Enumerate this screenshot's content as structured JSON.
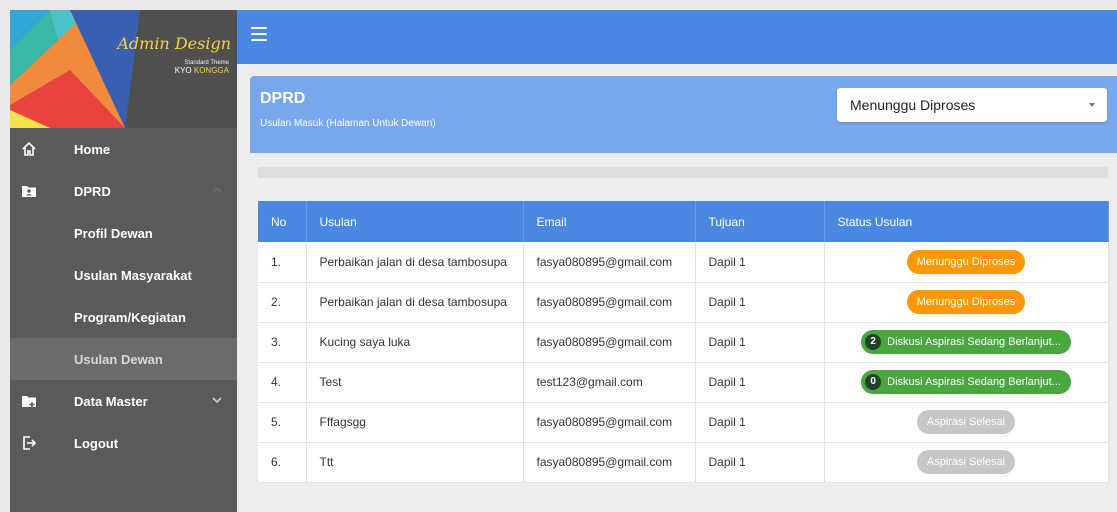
{
  "brand": {
    "title": "Admin Design",
    "subtitle": "Standard Theme",
    "credit_prefix": "KYO ",
    "credit_accent": "KONGGA"
  },
  "sidebar": {
    "items": [
      {
        "label": "Home",
        "icon": "home-icon"
      },
      {
        "label": "DPRD",
        "icon": "folder-user-icon"
      },
      {
        "label": "Profil Dewan"
      },
      {
        "label": "Usulan Masyarakat"
      },
      {
        "label": "Program/Kegiatan"
      },
      {
        "label": "Usulan Dewan"
      },
      {
        "label": "Data Master",
        "icon": "folder-plus-icon"
      },
      {
        "label": "Logout",
        "icon": "logout-icon"
      }
    ]
  },
  "header": {
    "title": "DPRD",
    "subtitle": "Usulan Masuk (Halaman Untuk Dewan)",
    "filter_value": "Menunggu Diproses"
  },
  "table": {
    "columns": [
      "No",
      "Usulan",
      "Email",
      "Tujuan",
      "Status Usulan"
    ],
    "rows": [
      {
        "no": "1.",
        "usulan": "Perbaikan jalan di desa tambosupa",
        "email": "fasya080895@gmail.com",
        "tujuan": "Dapil 1",
        "status": "Menunggu Diproses",
        "count": ""
      },
      {
        "no": "2.",
        "usulan": "Perbaikan jalan di desa tambosupa",
        "email": "fasya080895@gmail.com",
        "tujuan": "Dapil 1",
        "status": "Menunggu Diproses",
        "count": ""
      },
      {
        "no": "3.",
        "usulan": "Kucing saya luka",
        "email": "fasya080895@gmail.com",
        "tujuan": "Dapil 1",
        "status": "Diskusi Aspirasi Sedang Berlanjut...",
        "count": "2"
      },
      {
        "no": "4.",
        "usulan": "Test",
        "email": "test123@gmail.com",
        "tujuan": "Dapil 1",
        "status": "Diskusi Aspirasi Sedang Berlanjut...",
        "count": "0"
      },
      {
        "no": "5.",
        "usulan": "Fffagsgg",
        "email": "fasya080895@gmail.com",
        "tujuan": "Dapil 1",
        "status": "Aspirasi Selesai",
        "count": ""
      },
      {
        "no": "6.",
        "usulan": "Ttt",
        "email": "fasya080895@gmail.com",
        "tujuan": "Dapil 1",
        "status": "Aspirasi Selesai",
        "count": ""
      }
    ]
  },
  "colors": {
    "primary": "#4a87e0",
    "header_card": "#78a7ec",
    "sidebar": "#5a5a5a",
    "status_waiting": "#ff9806",
    "status_discussion": "#4aa740",
    "status_done": "#c6c6c6"
  }
}
